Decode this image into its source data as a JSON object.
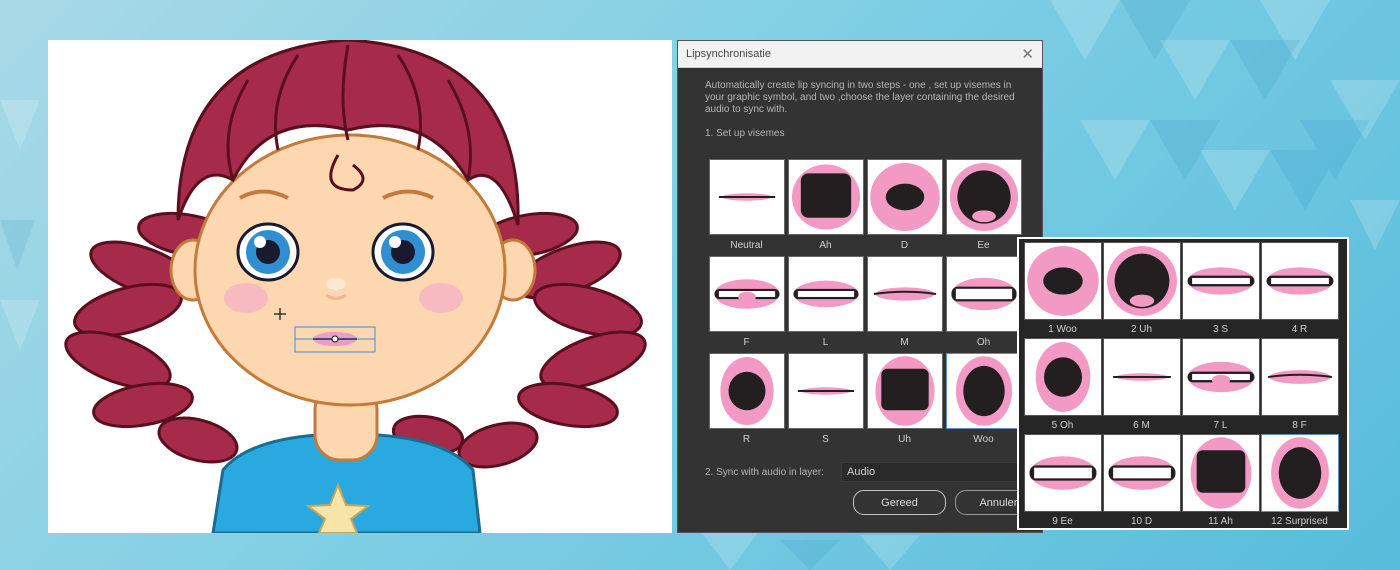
{
  "dialog": {
    "title": "Lipsynchronisatie",
    "close_icon": "close-icon",
    "description": "Automatically create lip syncing in two steps - one , set up visemes in your graphic symbol, and two ,choose the layer containing the desired audio to sync with.",
    "step1": "1. Set up visemes",
    "visemes": [
      {
        "label": "Neutral",
        "shape": "line"
      },
      {
        "label": "Ah",
        "shape": "wide"
      },
      {
        "label": "D",
        "shape": "round-small"
      },
      {
        "label": "Ee",
        "shape": "tongue"
      },
      {
        "label": "F",
        "shape": "teeth-tongue"
      },
      {
        "label": "L",
        "shape": "teeth"
      },
      {
        "label": "M",
        "shape": "closed"
      },
      {
        "label": "Oh",
        "shape": "teeth-open"
      },
      {
        "label": "R",
        "shape": "oval"
      },
      {
        "label": "S",
        "shape": "line"
      },
      {
        "label": "Uh",
        "shape": "tall"
      },
      {
        "label": "Woo",
        "shape": "tall-oval"
      }
    ],
    "step2": "2. Sync with audio in layer:",
    "audio_layer": "Audio",
    "done_label": "Gereed",
    "cancel_label": "Annulere"
  },
  "overlay": {
    "visemes": [
      {
        "label": "1 Woo",
        "shape": "round-small"
      },
      {
        "label": "2 Uh",
        "shape": "tongue"
      },
      {
        "label": "3 S",
        "shape": "teeth"
      },
      {
        "label": "4 R",
        "shape": "teeth"
      },
      {
        "label": "5 Oh",
        "shape": "oval"
      },
      {
        "label": "6 M",
        "shape": "line"
      },
      {
        "label": "7 L",
        "shape": "teeth-tongue"
      },
      {
        "label": "8 F",
        "shape": "closed"
      },
      {
        "label": "9 Ee",
        "shape": "teeth-open"
      },
      {
        "label": "10 D",
        "shape": "teeth-open"
      },
      {
        "label": "11 Ah",
        "shape": "tall"
      },
      {
        "label": "12 Surprised",
        "shape": "tall-oval"
      }
    ]
  },
  "colors": {
    "lip": "#f29ac4",
    "mouth": "#231f20",
    "hair": "#a62a4a",
    "skin": "#fcd7b0",
    "shirt": "#29a9df",
    "star": "#f7e4a8"
  }
}
